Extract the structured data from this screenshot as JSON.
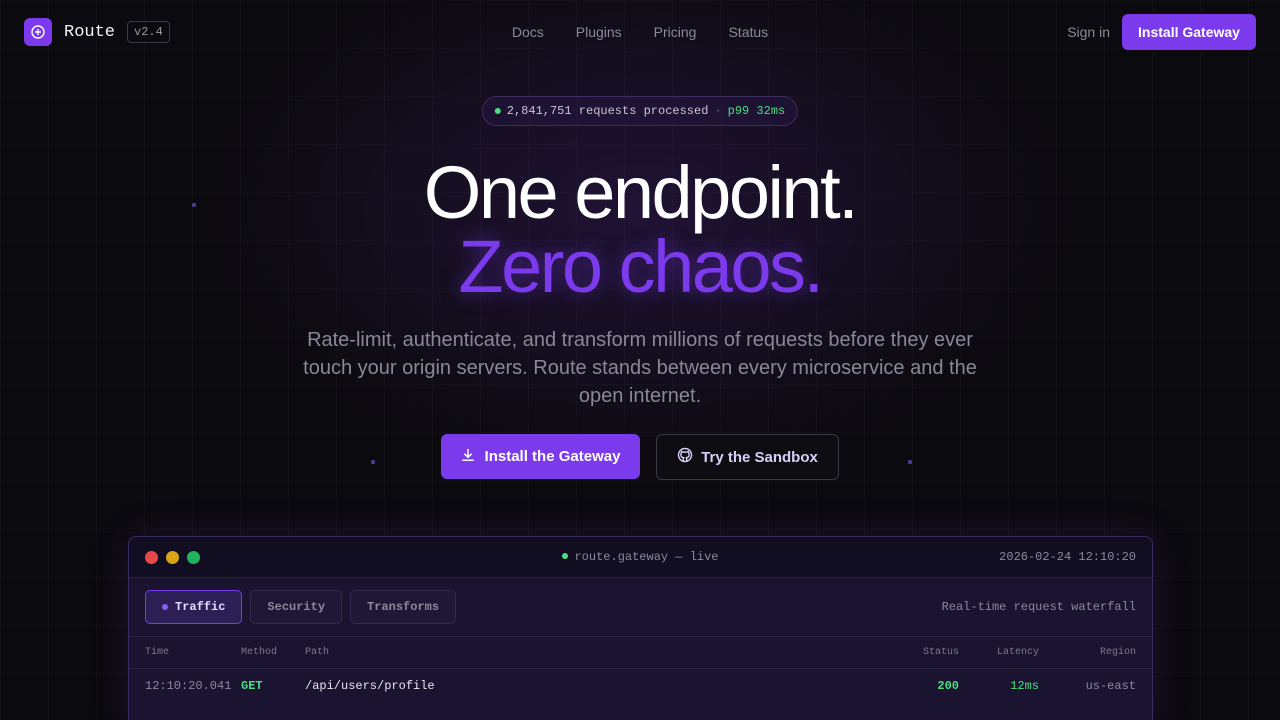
{
  "nav": {
    "brand": "Route",
    "version": "v2.4",
    "links": [
      "Docs",
      "Plugins",
      "Pricing",
      "Status"
    ],
    "signin": "Sign in",
    "cta": "Install Gateway"
  },
  "hero": {
    "stats": {
      "requests": "2,841,751 requests processed",
      "separator": "·",
      "p99": "p99 32ms"
    },
    "headline_line1": "One endpoint.",
    "headline_line2": "Zero chaos.",
    "subtitle": "Rate-limit, authenticate, and transform millions of requests before they ever touch your origin servers. Route stands between every microservice and the open internet.",
    "cta_primary": "Install the Gateway",
    "cta_secondary": "Try the Sandbox"
  },
  "console": {
    "title": "route.gateway — live",
    "timestamp": "2026-02-24 12:10:20",
    "tabs": [
      "Traffic",
      "Security",
      "Transforms"
    ],
    "active_tab": "Traffic",
    "caption": "Real-time request waterfall",
    "columns": {
      "time": "Time",
      "method": "Method",
      "path": "Path",
      "status": "Status",
      "latency": "Latency",
      "region": "Region"
    },
    "rows": [
      {
        "time": "12:10:20.041",
        "method": "GET",
        "path": "/api/users/profile",
        "status": "200",
        "latency": "12ms",
        "region": "us-east"
      }
    ]
  },
  "colors": {
    "accent": "#7c3aed",
    "success": "#4ade80",
    "background": "#0b0a0e",
    "traffic_red": "#e5484d",
    "traffic_yellow": "#d9a514",
    "traffic_green": "#22b35e"
  },
  "icons": {
    "logo": "route-logo-icon",
    "install": "download-icon",
    "sandbox": "github-icon",
    "status": "live-dot-icon"
  }
}
